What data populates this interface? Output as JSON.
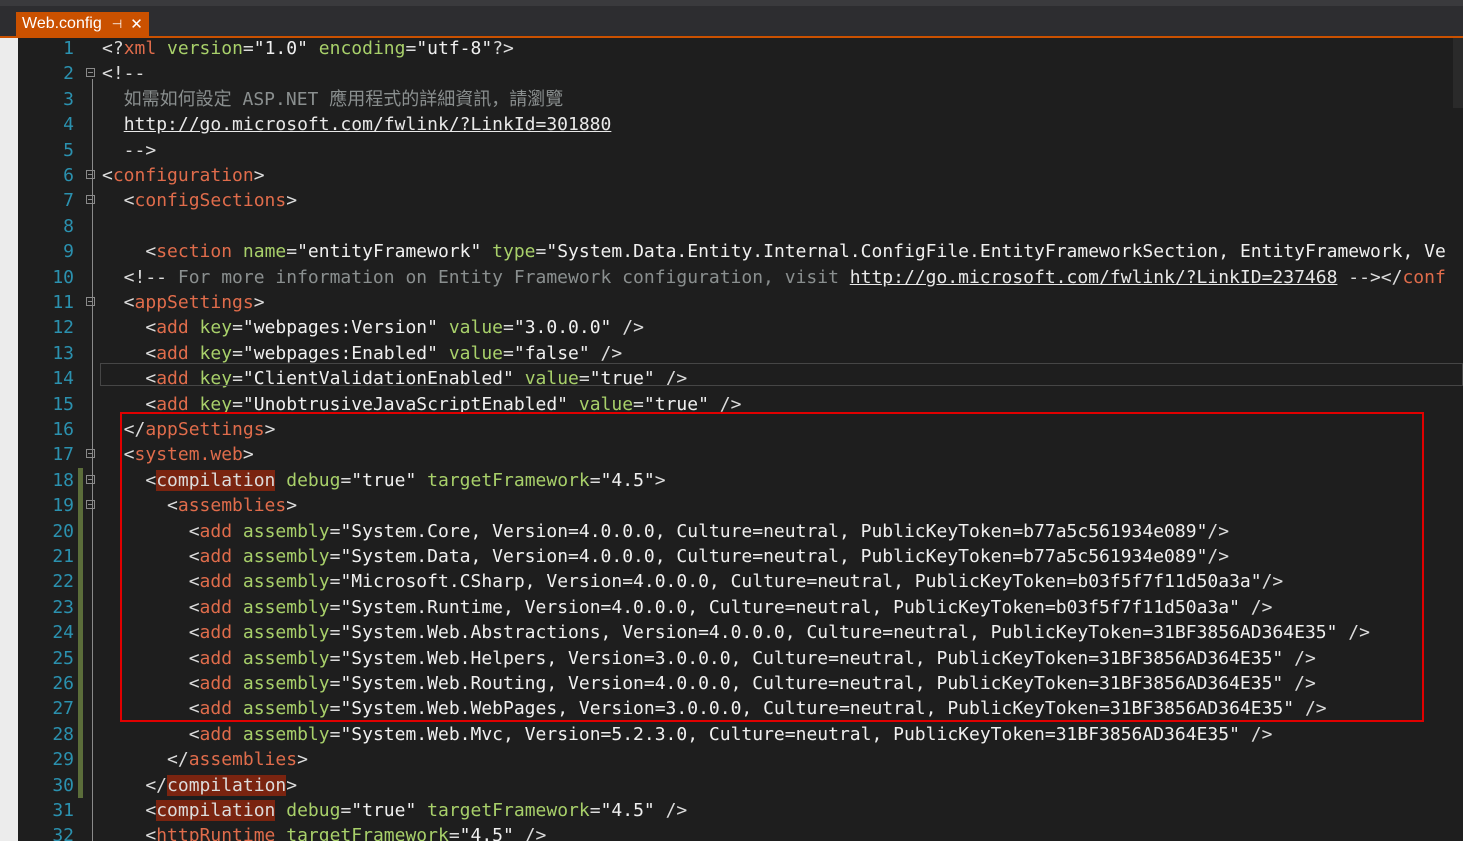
{
  "tab": {
    "title": "Web.config",
    "pin_icon": "pin-icon",
    "close_icon": "close-icon"
  },
  "colors": {
    "accent": "#ca5100",
    "tag": "#e06c4b",
    "attribute": "#a8d06a",
    "comment": "#8a8f8f",
    "line_number": "#2b91af",
    "highlight_box": "#e00000"
  },
  "lines": [
    {
      "n": "1",
      "segs": [
        [
          "b",
          "<?"
        ],
        [
          "t",
          "xml"
        ],
        [
          "b",
          " "
        ],
        [
          "a",
          "version"
        ],
        [
          "b",
          "="
        ],
        [
          "v",
          "\"1.0\""
        ],
        [
          "b",
          " "
        ],
        [
          "a",
          "encoding"
        ],
        [
          "b",
          "="
        ],
        [
          "v",
          "\"utf-8\""
        ],
        [
          "b",
          "?>"
        ]
      ]
    },
    {
      "n": "2",
      "segs": [
        [
          "b",
          "<!--"
        ]
      ]
    },
    {
      "n": "3",
      "segs": [
        [
          "c",
          "  如需如何設定 ASP.NET 應用程式的詳細資訊，請瀏覽"
        ]
      ]
    },
    {
      "n": "4",
      "segs": [
        [
          "b",
          "  "
        ],
        [
          "u",
          "http://go.microsoft.com/fwlink/?LinkId=301880"
        ]
      ]
    },
    {
      "n": "5",
      "segs": [
        [
          "b",
          "  -->"
        ]
      ]
    },
    {
      "n": "6",
      "segs": [
        [
          "b",
          "<"
        ],
        [
          "t",
          "configuration"
        ],
        [
          "b",
          ">"
        ]
      ]
    },
    {
      "n": "7",
      "segs": [
        [
          "b",
          "  <"
        ],
        [
          "t",
          "configSections"
        ],
        [
          "b",
          ">"
        ]
      ]
    },
    {
      "n": "8",
      "segs": []
    },
    {
      "n": "9",
      "segs": [
        [
          "b",
          "    <"
        ],
        [
          "t",
          "section"
        ],
        [
          "b",
          " "
        ],
        [
          "a",
          "name"
        ],
        [
          "b",
          "="
        ],
        [
          "v",
          "\"entityFramework\""
        ],
        [
          "b",
          " "
        ],
        [
          "a",
          "type"
        ],
        [
          "b",
          "="
        ],
        [
          "v",
          "\"System.Data.Entity.Internal.ConfigFile.EntityFrameworkSection, EntityFramework, Ve"
        ]
      ]
    },
    {
      "n": "10",
      "segs": [
        [
          "b",
          "  <!--"
        ],
        [
          "c",
          " For more information on Entity Framework configuration, visit "
        ],
        [
          "u",
          "http://go.microsoft.com/fwlink/?LinkID=237468"
        ],
        [
          "b",
          " --></"
        ],
        [
          "t",
          "conf"
        ]
      ]
    },
    {
      "n": "11",
      "segs": [
        [
          "b",
          "  <"
        ],
        [
          "t",
          "appSettings"
        ],
        [
          "b",
          ">"
        ]
      ]
    },
    {
      "n": "12",
      "segs": [
        [
          "b",
          "    <"
        ],
        [
          "t",
          "add"
        ],
        [
          "b",
          " "
        ],
        [
          "a",
          "key"
        ],
        [
          "b",
          "="
        ],
        [
          "v",
          "\"webpages:Version\""
        ],
        [
          "b",
          " "
        ],
        [
          "a",
          "value"
        ],
        [
          "b",
          "="
        ],
        [
          "v",
          "\"3.0.0.0\""
        ],
        [
          "b",
          " />"
        ]
      ]
    },
    {
      "n": "13",
      "segs": [
        [
          "b",
          "    <"
        ],
        [
          "t",
          "add"
        ],
        [
          "b",
          " "
        ],
        [
          "a",
          "key"
        ],
        [
          "b",
          "="
        ],
        [
          "v",
          "\"webpages:Enabled\""
        ],
        [
          "b",
          " "
        ],
        [
          "a",
          "value"
        ],
        [
          "b",
          "="
        ],
        [
          "v",
          "\"false\""
        ],
        [
          "b",
          " />"
        ]
      ]
    },
    {
      "n": "14",
      "segs": [
        [
          "b",
          "    <"
        ],
        [
          "t",
          "add"
        ],
        [
          "b",
          " "
        ],
        [
          "a",
          "key"
        ],
        [
          "b",
          "="
        ],
        [
          "v",
          "\"ClientValidationEnabled\""
        ],
        [
          "b",
          " "
        ],
        [
          "a",
          "value"
        ],
        [
          "b",
          "="
        ],
        [
          "v",
          "\"true\""
        ],
        [
          "b",
          " />"
        ]
      ]
    },
    {
      "n": "15",
      "segs": [
        [
          "b",
          "    <"
        ],
        [
          "t",
          "add"
        ],
        [
          "b",
          " "
        ],
        [
          "a",
          "key"
        ],
        [
          "b",
          "="
        ],
        [
          "v",
          "\"UnobtrusiveJavaScriptEnabled\""
        ],
        [
          "b",
          " "
        ],
        [
          "a",
          "value"
        ],
        [
          "b",
          "="
        ],
        [
          "v",
          "\"true\""
        ],
        [
          "b",
          " />"
        ]
      ]
    },
    {
      "n": "16",
      "segs": [
        [
          "b",
          "  </"
        ],
        [
          "t",
          "appSettings"
        ],
        [
          "b",
          ">"
        ]
      ]
    },
    {
      "n": "17",
      "segs": [
        [
          "b",
          "  <"
        ],
        [
          "t",
          "system.web"
        ],
        [
          "b",
          ">"
        ]
      ]
    },
    {
      "n": "18",
      "segs": [
        [
          "b",
          "    <"
        ],
        [
          "h",
          "compilation"
        ],
        [
          "b",
          " "
        ],
        [
          "a",
          "debug"
        ],
        [
          "b",
          "="
        ],
        [
          "v",
          "\"true\""
        ],
        [
          "b",
          " "
        ],
        [
          "a",
          "targetFramework"
        ],
        [
          "b",
          "="
        ],
        [
          "v",
          "\"4.5\""
        ],
        [
          "b",
          ">"
        ]
      ]
    },
    {
      "n": "19",
      "segs": [
        [
          "b",
          "      <"
        ],
        [
          "t",
          "assemblies"
        ],
        [
          "b",
          ">"
        ]
      ]
    },
    {
      "n": "20",
      "segs": [
        [
          "b",
          "        <"
        ],
        [
          "t",
          "add"
        ],
        [
          "b",
          " "
        ],
        [
          "a",
          "assembly"
        ],
        [
          "b",
          "="
        ],
        [
          "v",
          "\"System.Core, Version=4.0.0.0, Culture=neutral, PublicKeyToken=b77a5c561934e089\""
        ],
        [
          "b",
          "/>"
        ]
      ]
    },
    {
      "n": "21",
      "segs": [
        [
          "b",
          "        <"
        ],
        [
          "t",
          "add"
        ],
        [
          "b",
          " "
        ],
        [
          "a",
          "assembly"
        ],
        [
          "b",
          "="
        ],
        [
          "v",
          "\"System.Data, Version=4.0.0.0, Culture=neutral, PublicKeyToken=b77a5c561934e089\""
        ],
        [
          "b",
          "/>"
        ]
      ]
    },
    {
      "n": "22",
      "segs": [
        [
          "b",
          "        <"
        ],
        [
          "t",
          "add"
        ],
        [
          "b",
          " "
        ],
        [
          "a",
          "assembly"
        ],
        [
          "b",
          "="
        ],
        [
          "v",
          "\"Microsoft.CSharp, Version=4.0.0.0, Culture=neutral, PublicKeyToken=b03f5f7f11d50a3a\""
        ],
        [
          "b",
          "/>"
        ]
      ]
    },
    {
      "n": "23",
      "segs": [
        [
          "b",
          "        <"
        ],
        [
          "t",
          "add"
        ],
        [
          "b",
          " "
        ],
        [
          "a",
          "assembly"
        ],
        [
          "b",
          "="
        ],
        [
          "v",
          "\"System.Runtime, Version=4.0.0.0, Culture=neutral, PublicKeyToken=b03f5f7f11d50a3a\""
        ],
        [
          "b",
          " />"
        ]
      ]
    },
    {
      "n": "24",
      "segs": [
        [
          "b",
          "        <"
        ],
        [
          "t",
          "add"
        ],
        [
          "b",
          " "
        ],
        [
          "a",
          "assembly"
        ],
        [
          "b",
          "="
        ],
        [
          "v",
          "\"System.Web.Abstractions, Version=4.0.0.0, Culture=neutral, PublicKeyToken=31BF3856AD364E35\""
        ],
        [
          "b",
          " />"
        ]
      ]
    },
    {
      "n": "25",
      "segs": [
        [
          "b",
          "        <"
        ],
        [
          "t",
          "add"
        ],
        [
          "b",
          " "
        ],
        [
          "a",
          "assembly"
        ],
        [
          "b",
          "="
        ],
        [
          "v",
          "\"System.Web.Helpers, Version=3.0.0.0, Culture=neutral, PublicKeyToken=31BF3856AD364E35\""
        ],
        [
          "b",
          " />"
        ]
      ]
    },
    {
      "n": "26",
      "segs": [
        [
          "b",
          "        <"
        ],
        [
          "t",
          "add"
        ],
        [
          "b",
          " "
        ],
        [
          "a",
          "assembly"
        ],
        [
          "b",
          "="
        ],
        [
          "v",
          "\"System.Web.Routing, Version=4.0.0.0, Culture=neutral, PublicKeyToken=31BF3856AD364E35\""
        ],
        [
          "b",
          " />"
        ]
      ]
    },
    {
      "n": "27",
      "segs": [
        [
          "b",
          "        <"
        ],
        [
          "t",
          "add"
        ],
        [
          "b",
          " "
        ],
        [
          "a",
          "assembly"
        ],
        [
          "b",
          "="
        ],
        [
          "v",
          "\"System.Web.WebPages, Version=3.0.0.0, Culture=neutral, PublicKeyToken=31BF3856AD364E35\""
        ],
        [
          "b",
          " />"
        ]
      ]
    },
    {
      "n": "28",
      "segs": [
        [
          "b",
          "        <"
        ],
        [
          "t",
          "add"
        ],
        [
          "b",
          " "
        ],
        [
          "a",
          "assembly"
        ],
        [
          "b",
          "="
        ],
        [
          "v",
          "\"System.Web.Mvc, Version=5.2.3.0, Culture=neutral, PublicKeyToken=31BF3856AD364E35\""
        ],
        [
          "b",
          " />"
        ]
      ]
    },
    {
      "n": "29",
      "segs": [
        [
          "b",
          "      </"
        ],
        [
          "t",
          "assemblies"
        ],
        [
          "b",
          ">"
        ]
      ]
    },
    {
      "n": "30",
      "segs": [
        [
          "b",
          "    </"
        ],
        [
          "h",
          "compilation"
        ],
        [
          "b",
          ">"
        ]
      ]
    },
    {
      "n": "31",
      "segs": [
        [
          "b",
          "    <"
        ],
        [
          "h",
          "compilation"
        ],
        [
          "b",
          " "
        ],
        [
          "a",
          "debug"
        ],
        [
          "b",
          "="
        ],
        [
          "v",
          "\"true\""
        ],
        [
          "b",
          " "
        ],
        [
          "a",
          "targetFramework"
        ],
        [
          "b",
          "="
        ],
        [
          "v",
          "\"4.5\""
        ],
        [
          "b",
          " />"
        ]
      ]
    },
    {
      "n": "32",
      "segs": [
        [
          "b",
          "    <"
        ],
        [
          "t",
          "httpRuntime"
        ],
        [
          "b",
          " "
        ],
        [
          "a",
          "targetFramework"
        ],
        [
          "b",
          "="
        ],
        [
          "v",
          "\"4.5\""
        ],
        [
          "b",
          " />"
        ]
      ]
    }
  ]
}
